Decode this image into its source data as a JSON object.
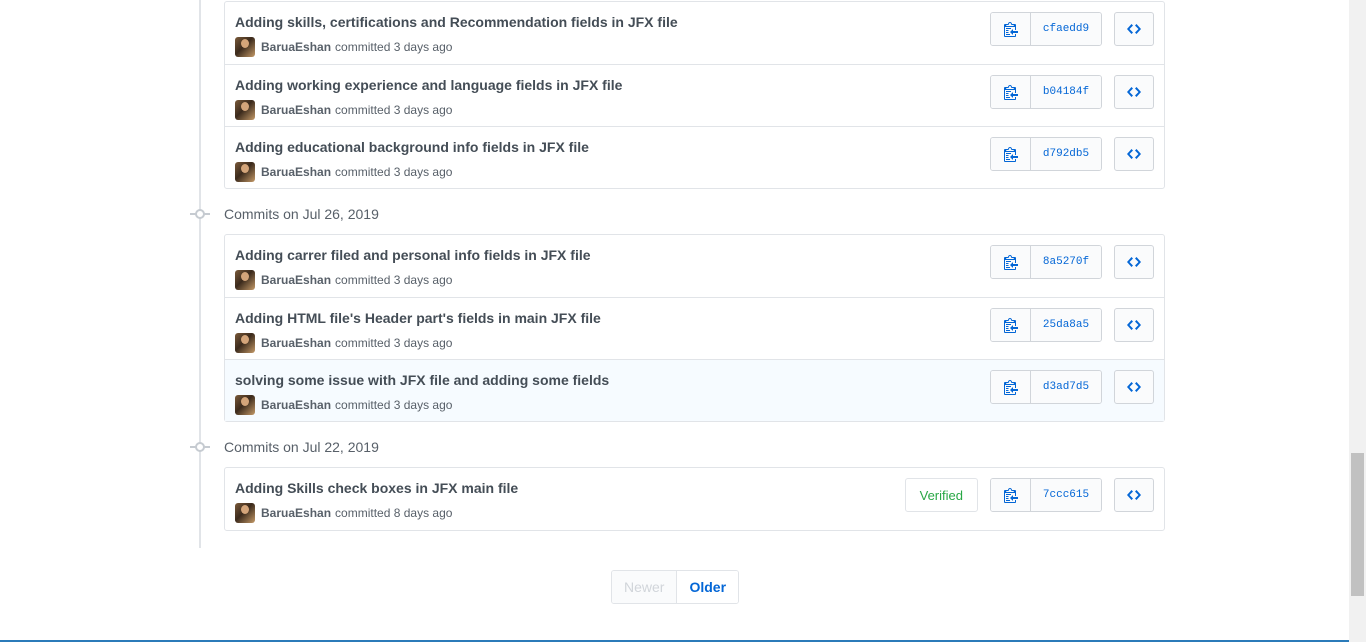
{
  "groups": [
    {
      "header": "",
      "commits": [
        {
          "title": "Adding skills, certifications and Recommendation fields in JFX file",
          "author": "BaruaEshan",
          "meta": "committed 3 days ago",
          "sha": "cfaedd9"
        },
        {
          "title": "Adding working experience and language fields in JFX file",
          "author": "BaruaEshan",
          "meta": "committed 3 days ago",
          "sha": "b04184f"
        },
        {
          "title": "Adding educational background info fields in JFX file",
          "author": "BaruaEshan",
          "meta": "committed 3 days ago",
          "sha": "d792db5"
        }
      ]
    },
    {
      "header": "Commits on Jul 26, 2019",
      "commits": [
        {
          "title": "Adding carrer filed and personal info fields in JFX file",
          "author": "BaruaEshan",
          "meta": "committed 3 days ago",
          "sha": "8a5270f"
        },
        {
          "title": "Adding HTML file's Header part's fields in main JFX file",
          "author": "BaruaEshan",
          "meta": "committed 3 days ago",
          "sha": "25da8a5"
        },
        {
          "title": "solving some issue with JFX file and adding some fields",
          "author": "BaruaEshan",
          "meta": "committed 3 days ago",
          "sha": "d3ad7d5"
        }
      ]
    },
    {
      "header": "Commits on Jul 22, 2019",
      "commits": [
        {
          "title": "Adding Skills check boxes in JFX main file",
          "author": "BaruaEshan",
          "meta": "committed 8 days ago",
          "sha": "7ccc615",
          "badge": "Verified"
        }
      ]
    }
  ],
  "pagination": {
    "newer": "Newer",
    "older": "Older"
  },
  "colors": {
    "link": "#0366d6",
    "verified": "#28a745",
    "highlight_row": "#f6fbff"
  },
  "icons": {
    "copy": "clipboard-icon",
    "browse": "code-icon",
    "timeline": "commit-dot-icon"
  }
}
